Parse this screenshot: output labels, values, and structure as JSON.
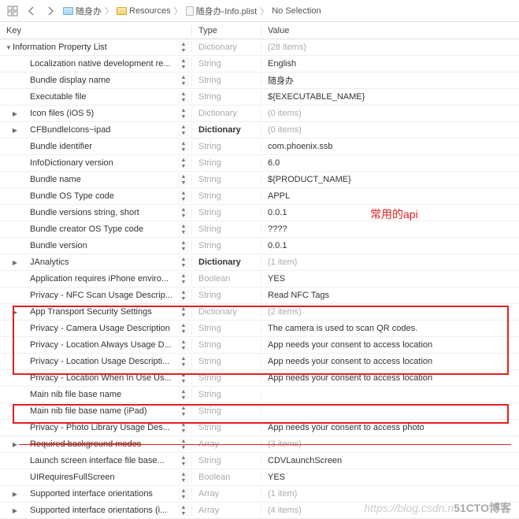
{
  "toolbar": {
    "crumbs": [
      {
        "icon": "folder-blue",
        "label": "随身办"
      },
      {
        "icon": "folder-yellow",
        "label": "Resources"
      },
      {
        "icon": "file",
        "label": "随身办-Info.plist"
      },
      {
        "icon": "",
        "label": "No Selection"
      }
    ]
  },
  "header": {
    "key": "Key",
    "type": "Type",
    "value": "Value"
  },
  "annotation": "常用的api",
  "watermark_left": "https://blog.csdn.n",
  "watermark_right": "51CTO博客",
  "rows": [
    {
      "indent": 0,
      "disclosure": "down",
      "key": "Information Property List",
      "type": "Dictionary",
      "typeMuted": true,
      "value": "(28 items)",
      "valueMuted": true
    },
    {
      "indent": 1,
      "disclosure": "",
      "key": "Localization native development re...",
      "type": "String",
      "typeMuted": true,
      "value": "English"
    },
    {
      "indent": 1,
      "disclosure": "",
      "key": "Bundle display name",
      "type": "String",
      "typeMuted": true,
      "value": "随身办"
    },
    {
      "indent": 1,
      "disclosure": "",
      "key": "Executable file",
      "type": "String",
      "typeMuted": true,
      "value": "${EXECUTABLE_NAME}"
    },
    {
      "indent": 1,
      "disclosure": "right",
      "key": "Icon files (iOS 5)",
      "type": "Dictionary",
      "typeMuted": true,
      "value": "(0 items)",
      "valueMuted": true
    },
    {
      "indent": 1,
      "disclosure": "right",
      "key": "CFBundleIcons~ipad",
      "type": "Dictionary",
      "typeStrong": true,
      "value": "(0 items)",
      "valueMuted": true
    },
    {
      "indent": 1,
      "disclosure": "",
      "key": "Bundle identifier",
      "type": "String",
      "typeMuted": true,
      "value": "com.phoenix.ssb"
    },
    {
      "indent": 1,
      "disclosure": "",
      "key": "InfoDictionary version",
      "type": "String",
      "typeMuted": true,
      "value": "6.0"
    },
    {
      "indent": 1,
      "disclosure": "",
      "key": "Bundle name",
      "type": "String",
      "typeMuted": true,
      "value": "${PRODUCT_NAME}"
    },
    {
      "indent": 1,
      "disclosure": "",
      "key": "Bundle OS Type code",
      "type": "String",
      "typeMuted": true,
      "value": "APPL"
    },
    {
      "indent": 1,
      "disclosure": "",
      "key": "Bundle versions string, short",
      "type": "String",
      "typeMuted": true,
      "value": "0.0.1"
    },
    {
      "indent": 1,
      "disclosure": "",
      "key": "Bundle creator OS Type code",
      "type": "String",
      "typeMuted": true,
      "value": "????"
    },
    {
      "indent": 1,
      "disclosure": "",
      "key": "Bundle version",
      "type": "String",
      "typeMuted": true,
      "value": "0.0.1"
    },
    {
      "indent": 1,
      "disclosure": "right",
      "key": "JAnalytics",
      "type": "Dictionary",
      "typeStrong": true,
      "value": "(1 item)",
      "valueMuted": true
    },
    {
      "indent": 1,
      "disclosure": "",
      "key": "Application requires iPhone enviro...",
      "type": "Boolean",
      "typeMuted": true,
      "value": "YES"
    },
    {
      "indent": 1,
      "disclosure": "",
      "key": "Privacy - NFC Scan Usage Descrip...",
      "type": "String",
      "typeMuted": true,
      "value": "Read NFC Tags"
    },
    {
      "indent": 1,
      "disclosure": "right",
      "key": "App Transport Security Settings",
      "type": "Dictionary",
      "typeMuted": true,
      "value": "(2 items)",
      "valueMuted": true
    },
    {
      "indent": 1,
      "disclosure": "",
      "key": "Privacy - Camera Usage Description",
      "type": "String",
      "typeMuted": true,
      "value": "The camera is used to scan QR codes."
    },
    {
      "indent": 1,
      "disclosure": "",
      "key": "Privacy - Location Always Usage D...",
      "type": "String",
      "typeMuted": true,
      "value": "App needs your consent to access location"
    },
    {
      "indent": 1,
      "disclosure": "",
      "key": "Privacy - Location Usage Descripti...",
      "type": "String",
      "typeMuted": true,
      "value": "App needs your consent to access location"
    },
    {
      "indent": 1,
      "disclosure": "",
      "key": "Privacy - Location When In Use Us...",
      "type": "String",
      "typeMuted": true,
      "value": "App needs your consent to access location"
    },
    {
      "indent": 1,
      "disclosure": "",
      "key": "Main nib file base name",
      "type": "String",
      "typeMuted": true,
      "value": ""
    },
    {
      "indent": 1,
      "disclosure": "",
      "key": "Main nib file base name (iPad)",
      "type": "String",
      "typeMuted": true,
      "value": ""
    },
    {
      "indent": 1,
      "disclosure": "",
      "key": "Privacy - Photo Library Usage Des...",
      "type": "String",
      "typeMuted": true,
      "value": "App needs your consent to access photo"
    },
    {
      "indent": 1,
      "disclosure": "right",
      "key": "Required background modes",
      "type": "Array",
      "typeMuted": true,
      "value": "(3 items)",
      "valueMuted": true,
      "strike": true
    },
    {
      "indent": 1,
      "disclosure": "",
      "key": "Launch screen interface file base...",
      "type": "String",
      "typeMuted": true,
      "value": "CDVLaunchScreen"
    },
    {
      "indent": 1,
      "disclosure": "",
      "key": "UIRequiresFullScreen",
      "type": "Boolean",
      "typeMuted": true,
      "value": "YES"
    },
    {
      "indent": 1,
      "disclosure": "right",
      "key": "Supported interface orientations",
      "type": "Array",
      "typeMuted": true,
      "value": "(1 item)",
      "valueMuted": true
    },
    {
      "indent": 1,
      "disclosure": "right",
      "key": "Supported interface orientations (i...",
      "type": "Array",
      "typeMuted": true,
      "value": "(4 items)",
      "valueMuted": true
    }
  ]
}
